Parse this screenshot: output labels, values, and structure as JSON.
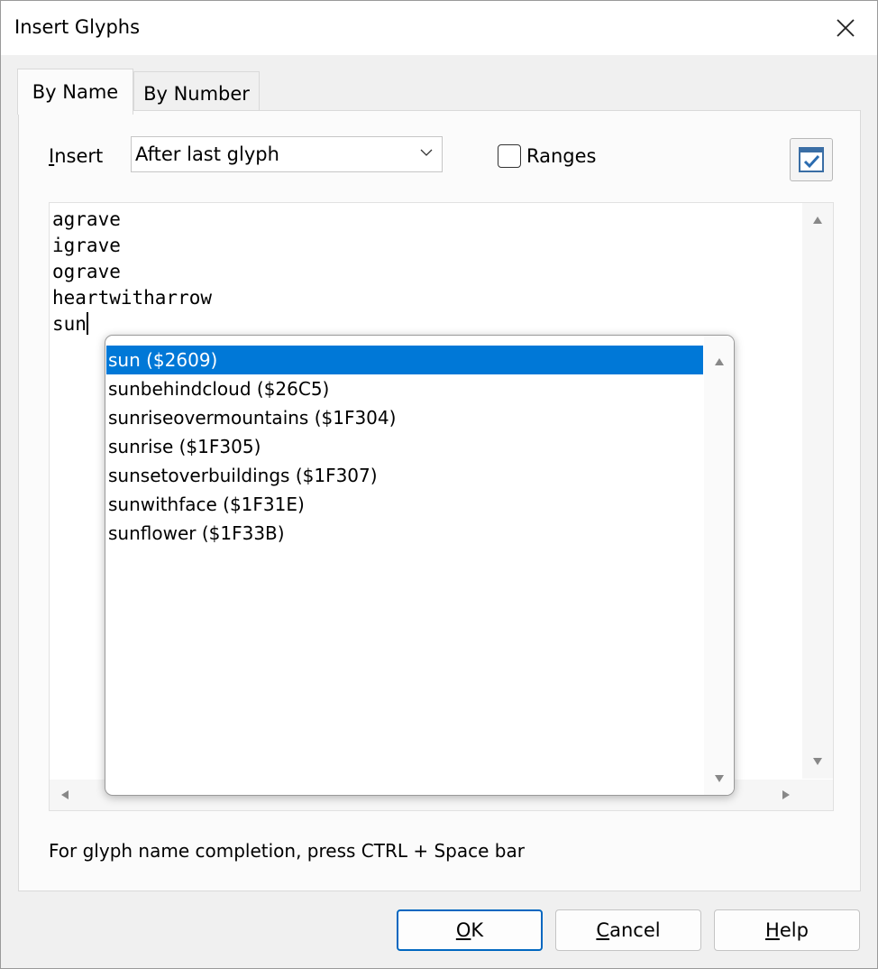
{
  "dialog": {
    "title": "Insert Glyphs",
    "close_icon": "close-icon"
  },
  "tabs": [
    {
      "label": "By Name",
      "active": true
    },
    {
      "label": "By Number",
      "active": false
    }
  ],
  "insert": {
    "label_first": "I",
    "label_rest": "nsert",
    "value": "After last glyph",
    "dropdown_icon": "chevron-down-icon"
  },
  "ranges": {
    "label": "Ranges",
    "checked": false
  },
  "options_button_icon": "checkbox-checked-icon",
  "editor": {
    "lines": [
      "agrave",
      "igrave",
      "ograve",
      "heartwitharrow"
    ],
    "current_line": "sun"
  },
  "autocomplete": {
    "items": [
      "sun ($2609)",
      "sunbehindcloud ($26C5)",
      "sunriseovermountains ($1F304)",
      "sunrise ($1F305)",
      "sunsetoverbuildings ($1F307)",
      "sunwithface ($1F31E)",
      "sunflower ($1F33B)"
    ],
    "selected_index": 0
  },
  "hint": "For glyph name completion, press CTRL + Space bar",
  "buttons": {
    "ok_mnemonic": "O",
    "ok_rest": "K",
    "cancel_mnemonic": "C",
    "cancel_rest": "ancel",
    "help_mnemonic": "H",
    "help_rest": "elp"
  },
  "colors": {
    "selection": "#0078d7",
    "accent": "#0067c0"
  }
}
